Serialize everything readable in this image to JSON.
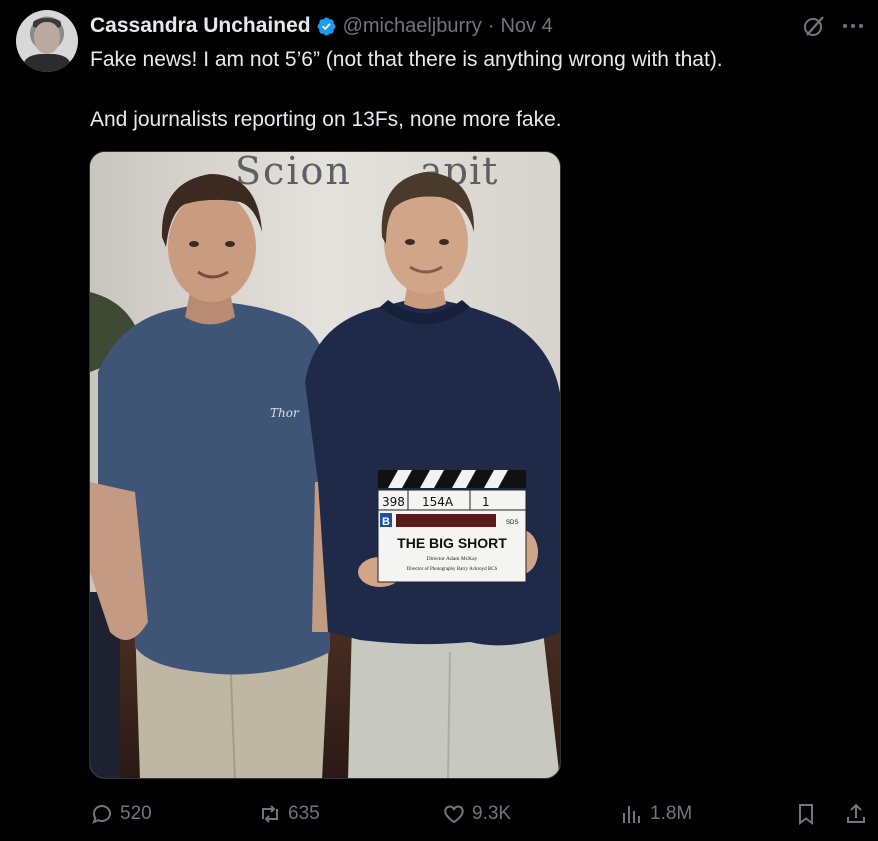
{
  "author": {
    "display_name": "Cassandra Unchained",
    "handle": "@michaeljburry",
    "separator": "·",
    "date": "Nov 4",
    "verified": true,
    "verified_color": "#1d9bf0"
  },
  "tweet": {
    "paragraphs": [
      "Fake news! I am not 5’6” (not that there is anything wrong with that).",
      "And journalists reporting on 13Fs, none more fake."
    ]
  },
  "media": {
    "wall_sign": "Scion Capital",
    "clapper": {
      "roll": "398",
      "scene": "154A",
      "take": "1",
      "camera": "B",
      "title": "THE BIG SHORT",
      "director_line": "Director  Adam McKay",
      "dp_line": "Director of Photography Barry Ackroyd BCS",
      "tag": "SDS"
    },
    "shirt_logo": "Thor"
  },
  "actions": {
    "replies": "520",
    "reposts": "635",
    "likes": "9.3K",
    "views": "1.8M"
  },
  "icons": {
    "grok": "grok-icon",
    "more": "more-icon",
    "reply": "reply-icon",
    "repost": "repost-icon",
    "like": "heart-icon",
    "views": "views-icon",
    "bookmark": "bookmark-icon",
    "share": "share-icon"
  },
  "colors": {
    "background": "#000000",
    "text": "#e7e9ea",
    "muted": "#71767b",
    "accent": "#1d9bf0"
  }
}
